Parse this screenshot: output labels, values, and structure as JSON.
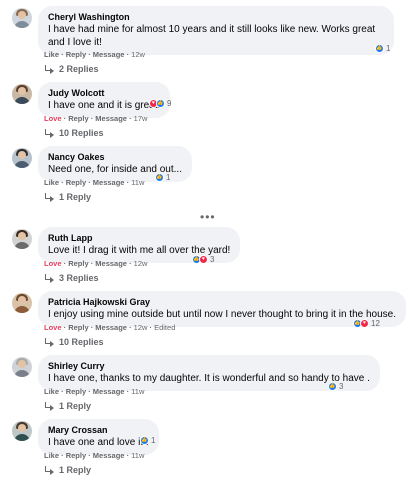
{
  "comments": [
    {
      "author": "Cheryl Washington",
      "text": "I have had mine for almost 10 years and it still looks like new. Works great and I love it!",
      "reaction": "Like",
      "reply": "Reply",
      "message": "Message",
      "time": "12w",
      "reaction_count": "1",
      "reaction_icons": [
        "like"
      ],
      "replies_label": "2 Replies",
      "avatar_colors": {
        "hair": "#8a6a4f",
        "body": "#7f8c9a",
        "bg": "#cfd6de"
      }
    },
    {
      "author": "Judy Wolcott",
      "text": "I have one and it is great!",
      "reaction": "Love",
      "reply": "Reply",
      "message": "Message",
      "time": "17w",
      "reaction_count": "9",
      "reaction_icons": [
        "love",
        "like"
      ],
      "replies_label": "10 Replies",
      "avatar_colors": {
        "hair": "#5c3d2e",
        "body": "#3b4a5a",
        "bg": "#c9b8a4"
      }
    },
    {
      "author": "Nancy Oakes",
      "text": "Need one, for inside and out...",
      "reaction": "Like",
      "reply": "Reply",
      "message": "Message",
      "time": "11w",
      "reaction_count": "1",
      "reaction_icons": [
        "like"
      ],
      "replies_label": "1 Reply",
      "avatar_colors": {
        "hair": "#2e2e2e",
        "body": "#4b5d6e",
        "bg": "#b7c2cc"
      }
    },
    {
      "author": "Ruth Lapp",
      "text": "Love it! I drag it with me all over the yard!",
      "reaction": "Love",
      "reply": "Reply",
      "message": "Message",
      "time": "12w",
      "reaction_count": "3",
      "reaction_icons": [
        "like",
        "love"
      ],
      "replies_label": "3 Replies",
      "avatar_colors": {
        "hair": "#3d2b1f",
        "body": "#6b6b6b",
        "bg": "#d3d3d3"
      }
    },
    {
      "author": "Patricia Hajkowski Gray",
      "text": "I enjoy using mine outside but until now I never thought to bring it in the house.",
      "reaction": "Love",
      "reply": "Reply",
      "message": "Message",
      "time": "12w",
      "edited": "Edited",
      "reaction_count": "12",
      "reaction_icons": [
        "like",
        "love"
      ],
      "replies_label": "10 Replies",
      "avatar_colors": {
        "hair": "#6b4a2f",
        "body": "#8c5b3a",
        "bg": "#d9c3a8"
      }
    },
    {
      "author": "Shirley Curry",
      "text": "I have one, thanks to my daughter. It is wonderful and so handy to have .",
      "reaction": "Like",
      "reply": "Reply",
      "message": "Message",
      "time": "11w",
      "reaction_count": "3",
      "reaction_icons": [
        "like"
      ],
      "replies_label": "1 Reply",
      "avatar_colors": {
        "hair": "#a9a9a9",
        "body": "#7a7f8a",
        "bg": "#cfd3d8"
      }
    },
    {
      "author": "Mary Crossan",
      "text": "I have one and love it !",
      "reaction": "Like",
      "reply": "Reply",
      "message": "Message",
      "time": "11w",
      "reaction_count": "1",
      "reaction_icons": [
        "like"
      ],
      "replies_label": "1 Reply",
      "avatar_colors": {
        "hair": "#4a3a30",
        "body": "#2f4f4f",
        "bg": "#bfc8c8"
      }
    }
  ],
  "more_options": "•••",
  "colors": {
    "like": "#1877f2",
    "love": "#f02849",
    "bubble": "#f0f2f5",
    "meta": "#65676b"
  }
}
